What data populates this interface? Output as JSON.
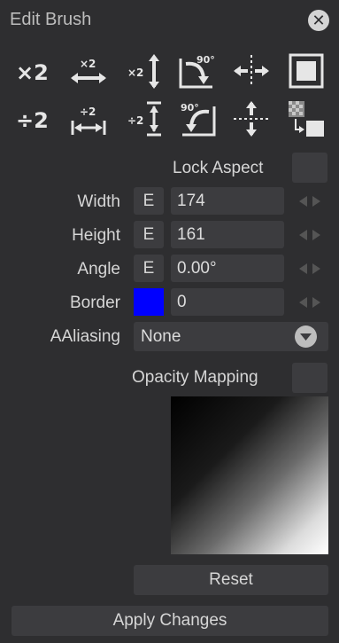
{
  "window": {
    "title": "Edit Brush"
  },
  "tools": {
    "row1": [
      "×2",
      "×2",
      "×2",
      "90°"
    ],
    "row2": [
      "÷2",
      "÷2",
      "÷2",
      "90°"
    ]
  },
  "lock_aspect": {
    "label": "Lock Aspect",
    "checked": false
  },
  "width": {
    "label": "Width",
    "expr_button": "E",
    "value": "174"
  },
  "height": {
    "label": "Height",
    "expr_button": "E",
    "value": "161"
  },
  "angle": {
    "label": "Angle",
    "expr_button": "E",
    "value": "0.00°"
  },
  "border": {
    "label": "Border",
    "color": "#0000ff",
    "value": "0"
  },
  "antialiasing": {
    "label": "AAliasing",
    "selected": "None"
  },
  "opacity_mapping": {
    "label": "Opacity Mapping",
    "checked": false
  },
  "buttons": {
    "reset": "Reset",
    "apply": "Apply Changes"
  }
}
